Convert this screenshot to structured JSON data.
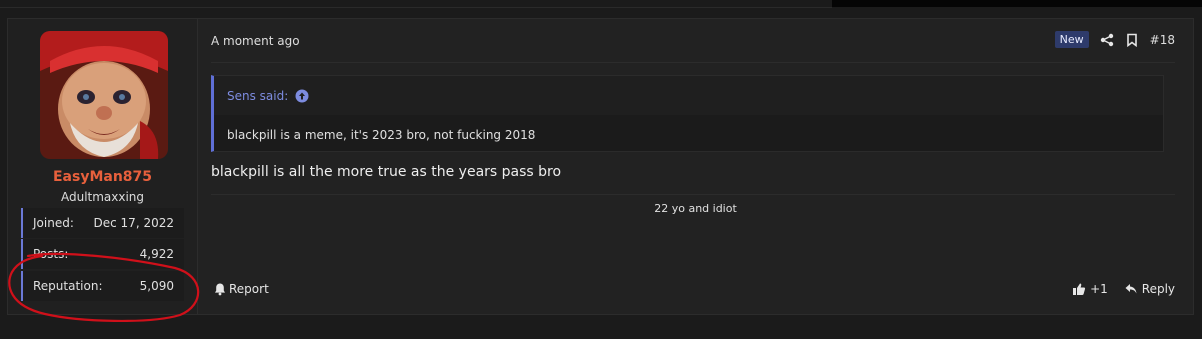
{
  "post": {
    "author": {
      "username": "EasyMan875",
      "title": "Adultmaxxing",
      "stats": [
        {
          "label": "Joined:",
          "value": "Dec 17, 2022"
        },
        {
          "label": "Posts:",
          "value": "4,922"
        },
        {
          "label": "Reputation:",
          "value": "5,090"
        }
      ]
    },
    "header": {
      "time": "A moment ago",
      "badge": "New",
      "post_number": "#18"
    },
    "quote": {
      "author_line": "Sens said:",
      "text": "blackpill is a meme, it's 2023 bro, not fucking 2018"
    },
    "message": "blackpill is all the more true as the years pass bro",
    "signature": "22 yo and idiot",
    "footer": {
      "report_label": "Report",
      "like_count": "+1",
      "reply_label": "Reply"
    }
  },
  "colors": {
    "username": "#e8603c",
    "accent": "#6b79d6",
    "annotation_circle": "#d0101a"
  },
  "icons": [
    "share-icon",
    "bookmark-icon",
    "arrow-up-circle-icon",
    "bell-icon",
    "thumbs-up-icon",
    "reply-icon"
  ]
}
